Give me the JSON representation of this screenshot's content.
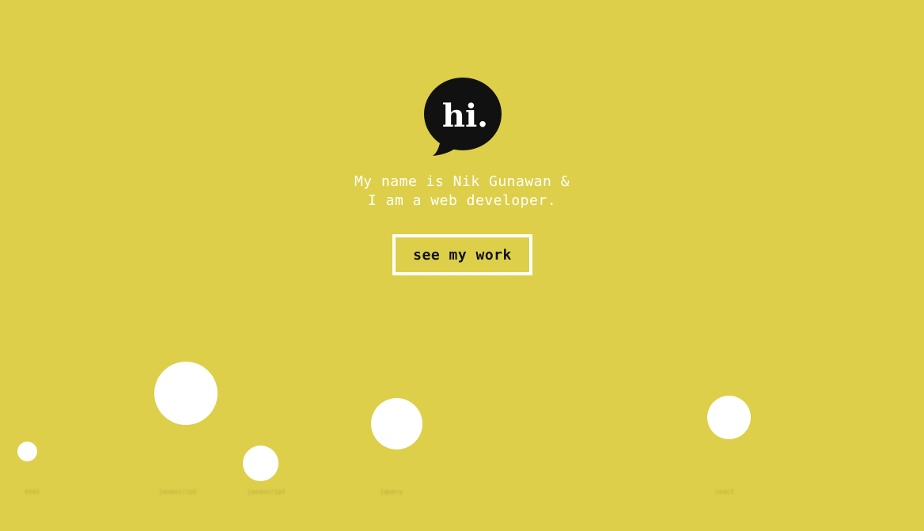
{
  "colors": {
    "background": "#ddcf49",
    "text": "#ffffff",
    "logo": "#111111",
    "button_text": "#111111",
    "bubble": "#ffffff"
  },
  "logo": {
    "text": "hi.",
    "icon": "speech-bubble-icon"
  },
  "intro": {
    "line1": "My name is Nik Gunawan &",
    "line2": "I am a web developer."
  },
  "cta": {
    "label": "see my work"
  },
  "bubbles": {
    "labels": [
      "html",
      "javascript",
      "javascript",
      "jquery",
      "react"
    ]
  }
}
